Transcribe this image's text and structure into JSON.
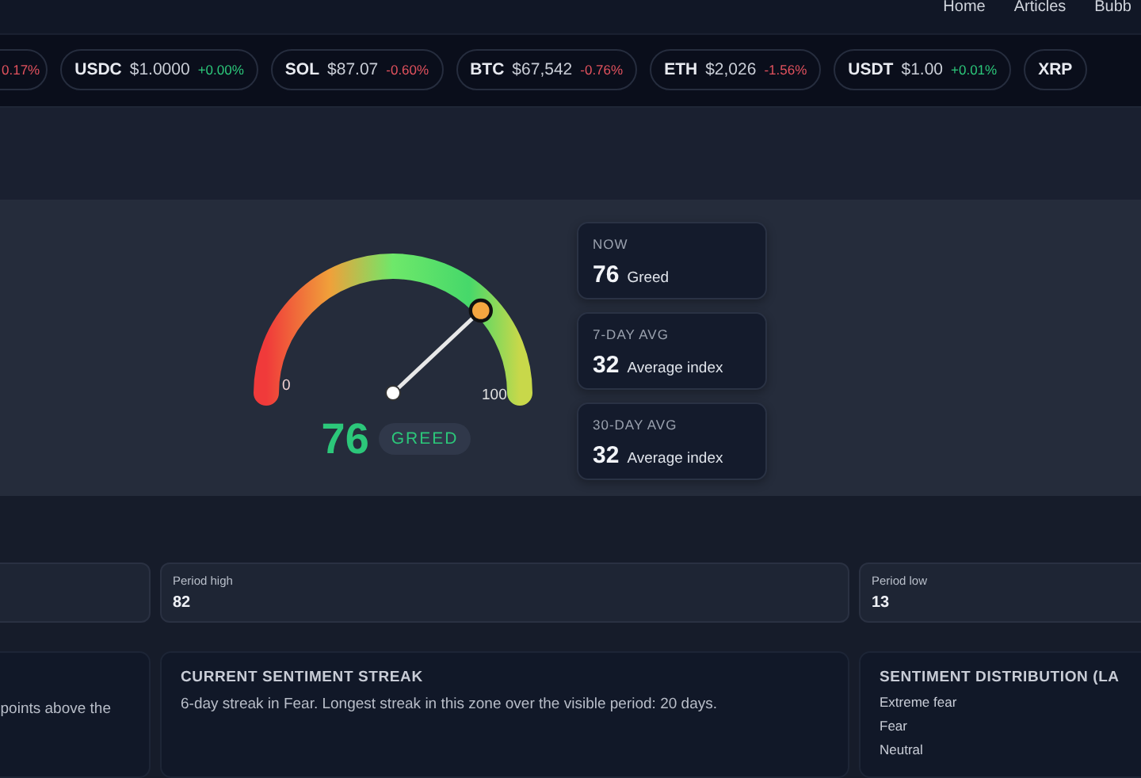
{
  "nav": {
    "links": [
      "Home",
      "Articles",
      "Bubb"
    ]
  },
  "ticker": [
    {
      "change": "0.17%",
      "color": "#e2525e"
    },
    {
      "symbol": "USDC",
      "price": "$1.0000",
      "change": "+0.00%",
      "color": "#2cc77a"
    },
    {
      "symbol": "SOL",
      "price": "$87.07",
      "change": "-0.60%",
      "color": "#e2525e"
    },
    {
      "symbol": "BTC",
      "price": "$67,542",
      "change": "-0.76%",
      "color": "#e2525e"
    },
    {
      "symbol": "ETH",
      "price": "$2,026",
      "change": "-1.56%",
      "color": "#e2525e"
    },
    {
      "symbol": "USDT",
      "price": "$1.00",
      "change": "+0.01%",
      "color": "#2cc77a"
    },
    {
      "symbol": "XRP"
    }
  ],
  "gauge": {
    "level": 0.76,
    "min_label": "0",
    "max_label": "100",
    "value": "76",
    "label": "GREED"
  },
  "summary_cards": [
    {
      "label": "NOW",
      "value": "76",
      "caption": "Greed"
    },
    {
      "label": "7-DAY AVG",
      "value": "32",
      "caption": "Average index"
    },
    {
      "label": "30-DAY AVG",
      "value": "32",
      "caption": "Average index"
    }
  ],
  "period_stats": [
    {
      "kind": "blank"
    },
    {
      "kind": "value",
      "label": "Period high",
      "value": "82"
    },
    {
      "kind": "value",
      "label": "Period low",
      "value": "13"
    }
  ],
  "info_cards": [
    {
      "body": "points above the"
    },
    {
      "title": "CURRENT SENTIMENT STREAK",
      "body": "6-day streak in Fear. Longest streak in this zone over the visible period: 20 days."
    },
    {
      "title": "SENTIMENT DISTRIBUTION (LA",
      "items": [
        "Extreme fear",
        "Fear",
        "Neutral"
      ]
    }
  ]
}
